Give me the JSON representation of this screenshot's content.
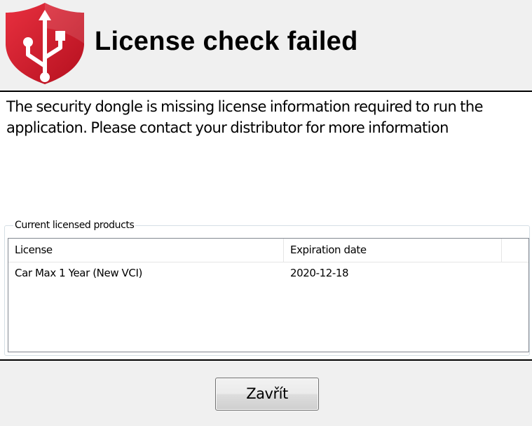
{
  "dialog": {
    "title": "License check failed",
    "icon": "security-dongle-shield-icon",
    "message": "The security dongle is missing license information required to run the application. Please contact your distributor for more information"
  },
  "licenses": {
    "group_label": "Current licensed products",
    "columns": [
      "License",
      "Expiration date"
    ],
    "rows": [
      {
        "license": "Car Max 1 Year (New VCI)",
        "expiration": "2020-12-18"
      }
    ]
  },
  "footer": {
    "close_label": "Zavřít"
  },
  "colors": {
    "shield_red": "#d7192c",
    "header_bg": "#f0f0f0",
    "content_bg": "#ffffff"
  }
}
